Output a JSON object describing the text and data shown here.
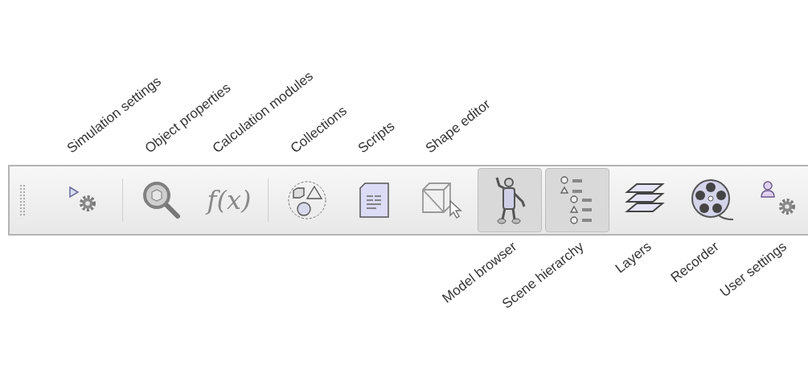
{
  "toolbar": {
    "items": [
      {
        "kind": "grip"
      },
      {
        "kind": "button",
        "label": "Simulation settings",
        "label_below": false,
        "selected": false
      },
      {
        "kind": "separator"
      },
      {
        "kind": "button",
        "label": "Object properties",
        "label_below": false,
        "selected": false
      },
      {
        "kind": "button",
        "label": "Calculation modules",
        "label_below": false,
        "selected": false,
        "glyph": "f(x)"
      },
      {
        "kind": "separator"
      },
      {
        "kind": "button",
        "label": "Collections",
        "label_below": false,
        "selected": false
      },
      {
        "kind": "button",
        "label": "Scripts",
        "label_below": false,
        "selected": false
      },
      {
        "kind": "button",
        "label": "Shape editor",
        "label_below": false,
        "selected": false
      },
      {
        "kind": "button",
        "label": "Model browser",
        "label_below": true,
        "selected": true
      },
      {
        "kind": "button",
        "label": "Scene hierarchy",
        "label_below": true,
        "selected": true
      },
      {
        "kind": "button",
        "label": "Layers",
        "label_below": true,
        "selected": false
      },
      {
        "kind": "button",
        "label": "Recorder",
        "label_below": true,
        "selected": false
      },
      {
        "kind": "button",
        "label": "User settings",
        "label_below": true,
        "selected": false
      }
    ]
  }
}
